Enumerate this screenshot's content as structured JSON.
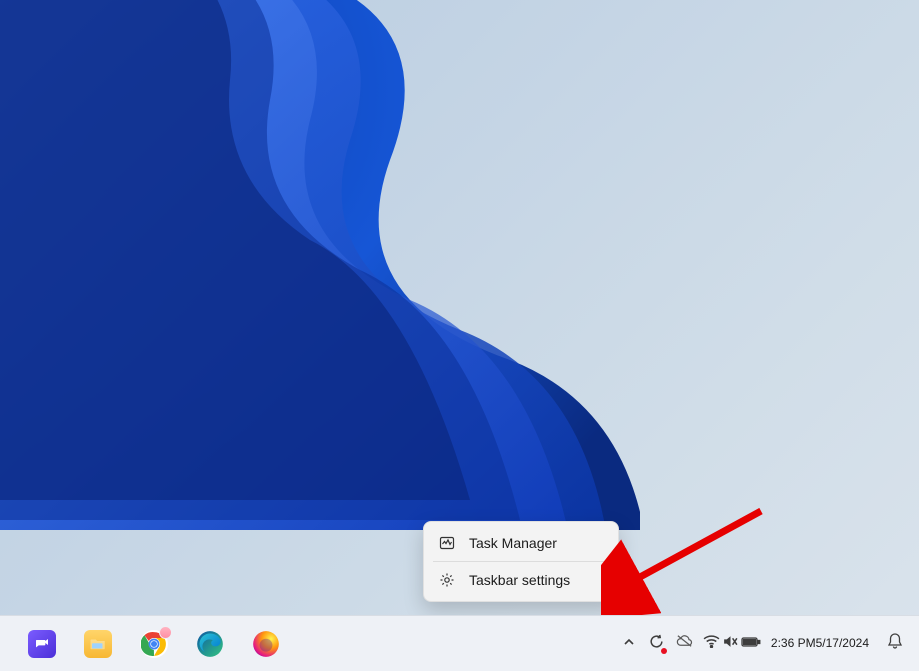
{
  "context_menu": {
    "task_manager": "Task Manager",
    "taskbar_settings": "Taskbar settings"
  },
  "system_tray": {
    "time": "2:36 PM",
    "date": "5/17/2024"
  },
  "taskbar_apps": [
    {
      "name": "chat-app-icon"
    },
    {
      "name": "file-explorer-icon"
    },
    {
      "name": "chrome-icon"
    },
    {
      "name": "edge-icon"
    },
    {
      "name": "firefox-icon"
    }
  ]
}
